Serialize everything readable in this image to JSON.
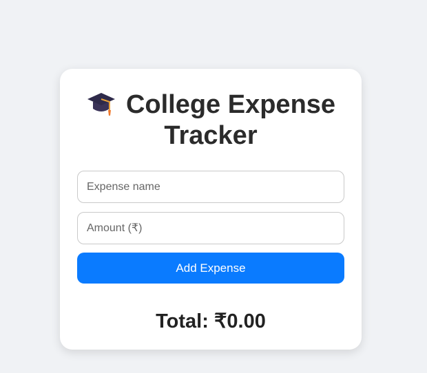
{
  "header": {
    "icon": "graduation-cap-icon",
    "title": "College Expense Tracker"
  },
  "form": {
    "name_placeholder": "Expense name",
    "amount_placeholder": "Amount (₹)",
    "add_label": "Add Expense"
  },
  "summary": {
    "label": "Total:",
    "currency": "₹",
    "amount": "0.00",
    "text": "Total: ₹0.00"
  },
  "colors": {
    "accent": "#0a7bff",
    "background": "#f0f2f5",
    "card": "#ffffff"
  }
}
